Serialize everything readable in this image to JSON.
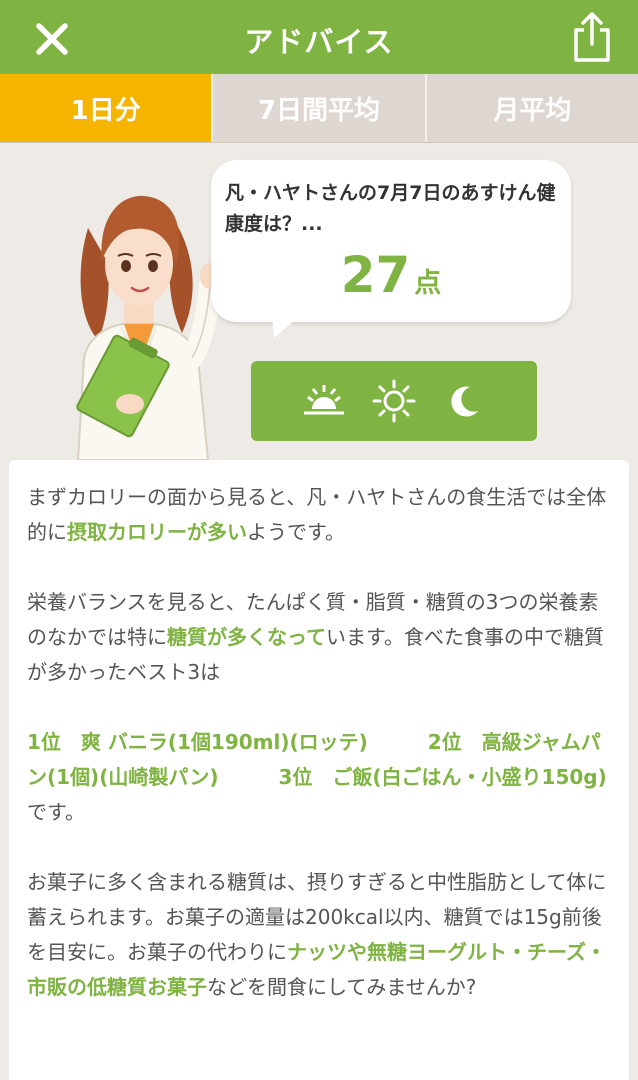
{
  "header": {
    "title": "アドバイス",
    "close_icon": "close-icon",
    "share_icon": "share-icon"
  },
  "tabs": [
    {
      "label": "1日分",
      "active": true
    },
    {
      "label": "7日間平均",
      "active": false
    },
    {
      "label": "月平均",
      "active": false
    }
  ],
  "bubble": {
    "text": "凡・ハヤトさんの7月7日のあすけん健康度は？...",
    "score": "27",
    "unit": "点"
  },
  "time_buttons": [
    {
      "icon": "sunrise-icon"
    },
    {
      "icon": "sun-icon"
    },
    {
      "icon": "moon-icon"
    }
  ],
  "advice": {
    "p1_a": "まずカロリーの面から見ると、凡・ハヤトさんの食生活では全体的に",
    "p1_hl": "摂取カロリーが多い",
    "p1_b": "ようです。",
    "p2_a": "栄養バランスを見ると、たんぱく質・脂質・糖質の3つの栄養素のなかでは特に",
    "p2_hl": "糖質が多くなって",
    "p2_b": "います。食べた食事の中で糖質が多かったベスト3は",
    "ranking": "1位　爽 バニラ(1個190ml)(ロッテ)　　　2位　高級ジャムパン(1個)(山崎製パン)　　　3位　ご飯(白ごはん・小盛り150g)",
    "ranking_end": "です。",
    "p3_a": "お菓子に多く含まれる糖質は、摂りすぎると中性脂肪として体に蓄えられます。お菓子の適量は200kcal以内、糖質では15g前後を目安に。お菓子の代わりに",
    "p3_hl": "ナッツや無糖ヨーグルト・チーズ・市販の低糖質お菓子",
    "p3_b": "などを間食にしてみませんか?"
  },
  "colors": {
    "brand_green": "#7fb342",
    "active_tab": "#f5b400",
    "inactive_tab": "#ddd6d1"
  }
}
